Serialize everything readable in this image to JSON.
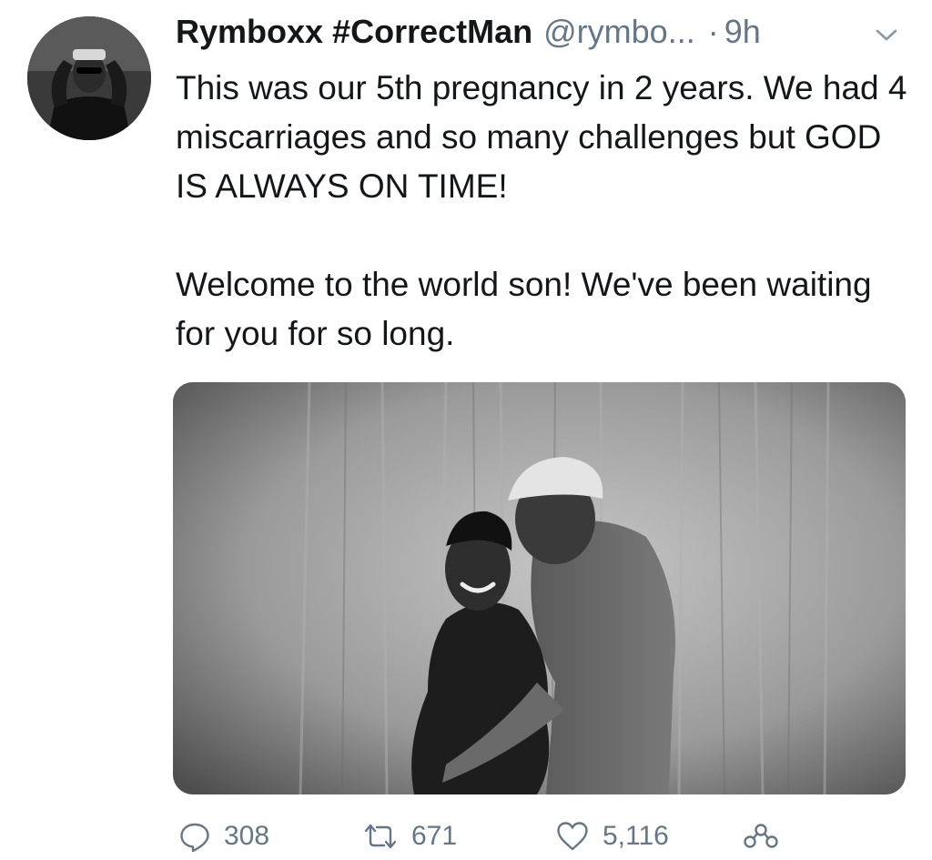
{
  "tweet": {
    "display_name": "Rymboxx #CorrectMan",
    "handle": "@rymbo...",
    "separator": "·",
    "timestamp": "9h",
    "body": [
      "This was our 5th pregnancy in 2 years. We had 4 miscarriages and so many challenges but GOD IS ALWAYS ON TIME!",
      "Welcome to the world son! We've been waiting for you for so long."
    ],
    "media": {
      "type": "photo",
      "style": "black-and-white"
    },
    "actions": {
      "replies": "308",
      "retweets": "671",
      "likes": "5,116"
    }
  },
  "icons": {
    "reply": "reply-icon",
    "retweet": "retweet-icon",
    "like": "heart-icon",
    "share": "share-icon",
    "menu": "chevron-down-icon"
  },
  "colors": {
    "text": "#14171a",
    "secondary": "#657786",
    "background": "#ffffff"
  }
}
